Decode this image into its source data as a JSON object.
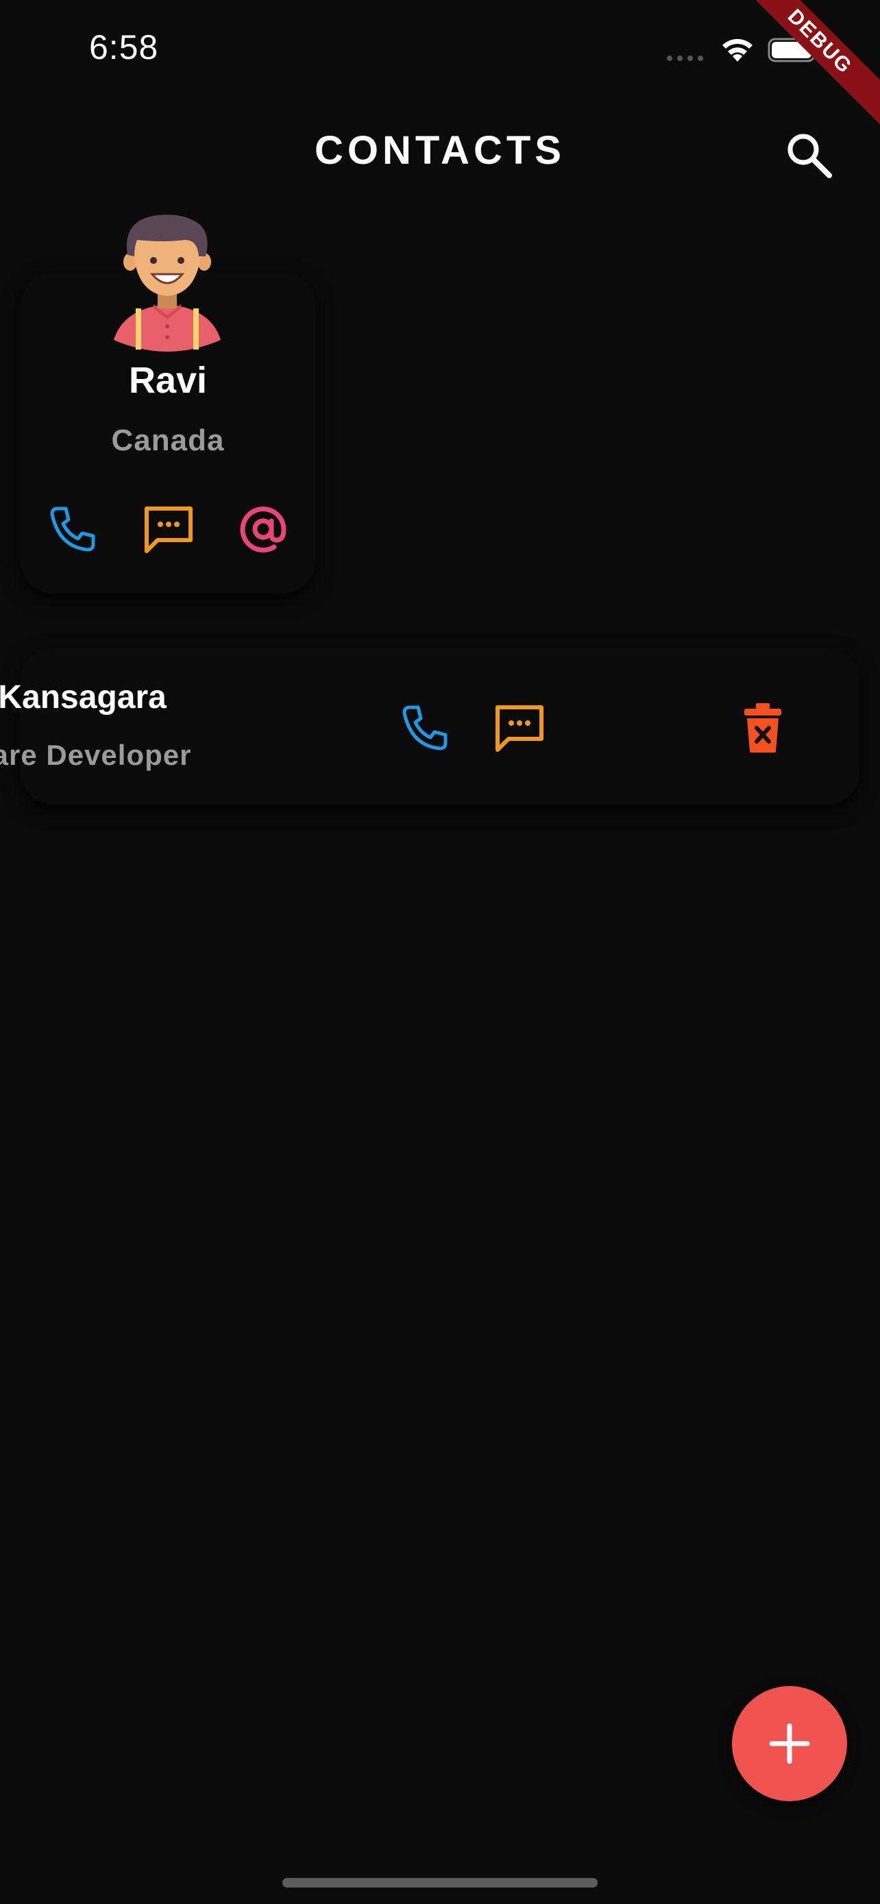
{
  "status_bar": {
    "time": "6:58",
    "debug_label": "DEBUG"
  },
  "header": {
    "title": "CONTACTS",
    "search_icon": "search-icon"
  },
  "grid_contact": {
    "name": "Ravi",
    "country": "Canada",
    "avatar": "avatar-boy",
    "actions": [
      "phone-icon",
      "message-icon",
      "email-icon"
    ]
  },
  "list_contact": {
    "name": "Ravi Kansagara",
    "job": "Software Developer",
    "visible_name": "vi Kansagara",
    "visible_job": "tware Developer",
    "actions": [
      "phone-icon",
      "message-icon",
      "delete-icon"
    ]
  },
  "fab": {
    "icon": "plus-icon"
  },
  "colors": {
    "background": "#0b0b0b",
    "phone": "#1e9be6",
    "message": "#f19a1a",
    "email": "#e8457a",
    "delete": "#f4511e",
    "fab": "#ef5350",
    "debug_ribbon": "#8a1216"
  }
}
